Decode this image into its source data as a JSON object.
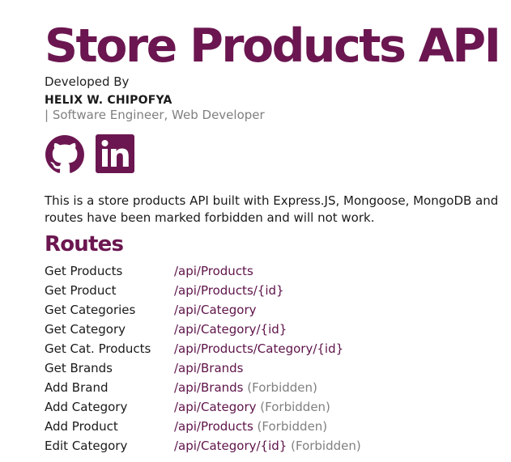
{
  "header": {
    "title": "Store Products API",
    "developed_by": "Developed By",
    "author_name": "HELIX W. CHIPOFYA",
    "author_role": "| Software Engineer, Web Developer"
  },
  "socials": [
    {
      "icon": "github-icon"
    },
    {
      "icon": "linkedin-icon"
    }
  ],
  "intro": {
    "line1": "This is a store products API built with Express.JS, Mongoose, MongoDB and",
    "line2": "routes have been marked forbidden and will not work."
  },
  "routes_section": {
    "heading": "Routes",
    "routes": [
      {
        "name": "Get Products",
        "path": "/api/Products",
        "note": ""
      },
      {
        "name": "Get Product",
        "path": "/api/Products/{id}",
        "note": ""
      },
      {
        "name": "Get Categories",
        "path": "/api/Category",
        "note": ""
      },
      {
        "name": "Get Category",
        "path": "/api/Category/{id}",
        "note": ""
      },
      {
        "name": "Get Cat. Products",
        "path": "/api/Products/Category/{id}",
        "note": ""
      },
      {
        "name": "Get Brands",
        "path": "/api/Brands",
        "note": ""
      },
      {
        "name": "Add Brand",
        "path": "/api/Brands",
        "note": "(Forbidden)"
      },
      {
        "name": "Add Category",
        "path": "/api/Category",
        "note": "(Forbidden)"
      },
      {
        "name": "Add Product",
        "path": "/api/Products",
        "note": "(Forbidden)"
      },
      {
        "name": "Edit Category",
        "path": "/api/Category/{id}",
        "note": "(Forbidden)"
      }
    ]
  },
  "colors": {
    "brand": "#6b1650",
    "link": "#5e1349",
    "muted": "#808080"
  }
}
